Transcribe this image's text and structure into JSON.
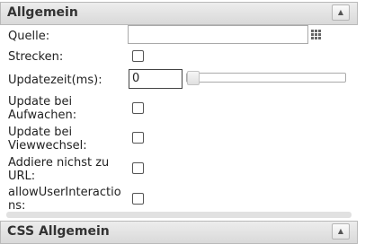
{
  "sections": {
    "general": {
      "title": "Allgemein"
    },
    "css_general": {
      "title": "CSS Allgemein"
    }
  },
  "fields": {
    "source": {
      "label": "Quelle:",
      "value": ""
    },
    "stretch": {
      "label": "Strecken:",
      "checked": false
    },
    "update_time": {
      "label": "Updatezeit(ms):",
      "value": "0",
      "slider_fraction": 0
    },
    "update_on_wake": {
      "label_line1": "Update bei",
      "label_line2": "Aufwachen:",
      "checked": false
    },
    "update_on_view_change": {
      "label_line1": "Update bei",
      "label_line2": "Viewwechsel:",
      "checked": false
    },
    "add_nocache_to_url": {
      "label_line1": "Addiere nichst zu",
      "label_line2": "URL:",
      "checked": false
    },
    "allow_user_interactions": {
      "label_line1": "allowUserInteractio",
      "label_line2": "ns:",
      "checked": false
    }
  },
  "icons": {
    "collapse": "triangle-up-icon",
    "picker": "grid-picker-icon"
  },
  "colors": {
    "header_bg": "#e3e3e3",
    "border": "#b9b9b9"
  }
}
